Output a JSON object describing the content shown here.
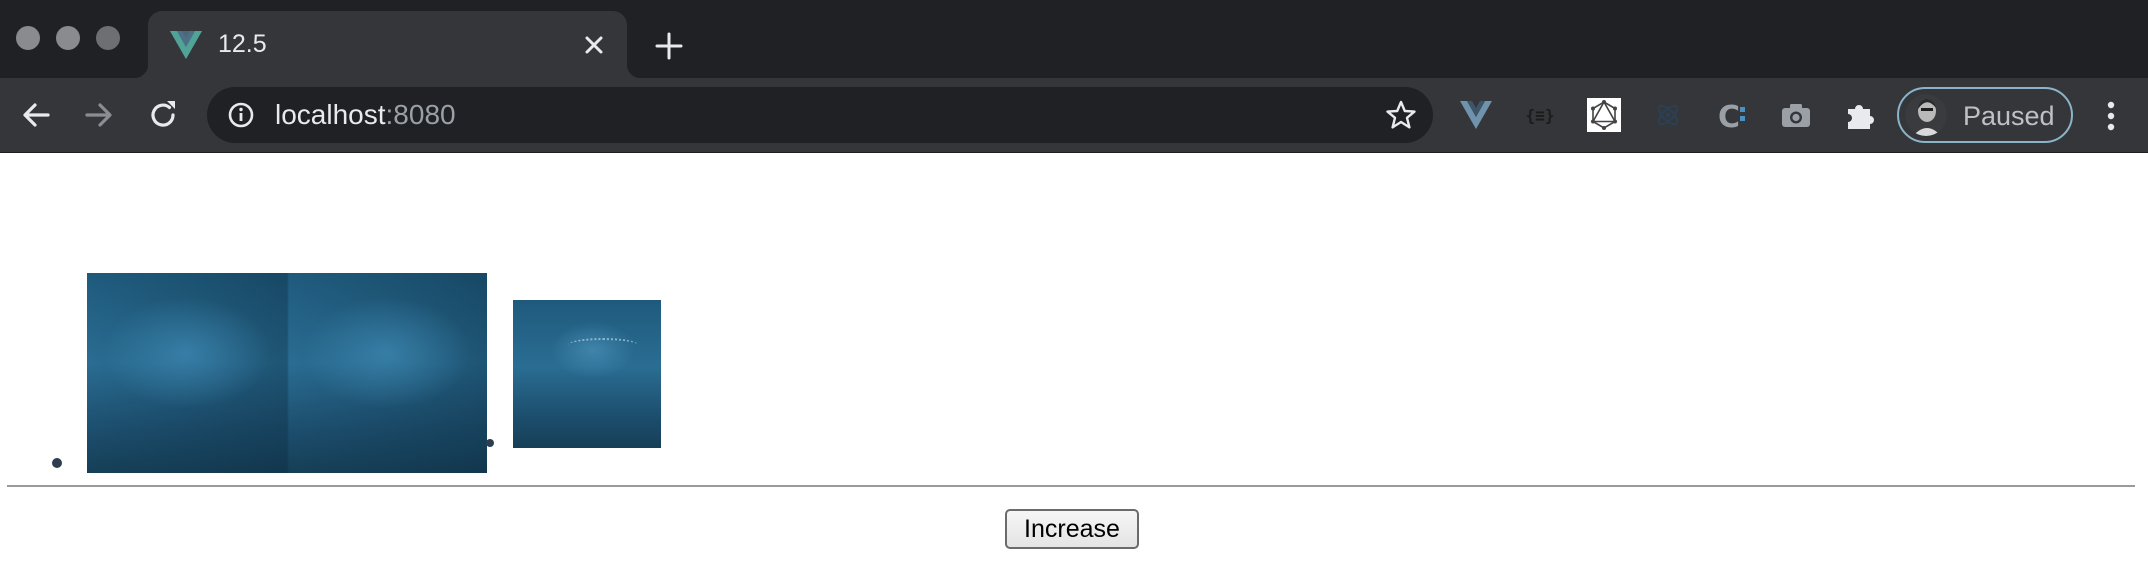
{
  "browser": {
    "tab": {
      "title": "12.5",
      "favicon": "vue-logo-icon"
    },
    "address_bar": {
      "host": "localhost",
      "port": ":8080"
    },
    "profile": {
      "label": "Paused"
    },
    "extensions": [
      "vue-devtools-icon",
      "json-viewer-icon",
      "graphql-icon",
      "react-devtools-icon",
      "c-extension-icon",
      "camera-icon",
      "puzzle-icon"
    ]
  },
  "page": {
    "images": [
      {
        "name": "underwater-image-large"
      },
      {
        "name": "underwater-image-small"
      }
    ],
    "increase_button": {
      "label": "Increase"
    }
  },
  "colors": {
    "tab_strip": "#202124",
    "toolbar": "#35363a",
    "omnibox": "#202124",
    "image_blue": "#2a6d93",
    "bullet": "#2c3e50"
  }
}
